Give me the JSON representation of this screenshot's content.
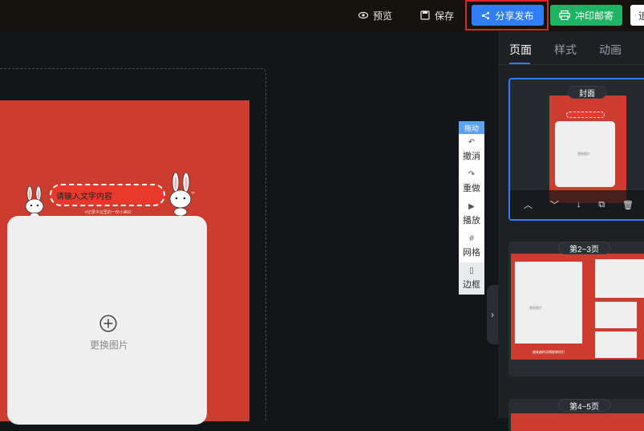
{
  "topbar": {
    "preview_label": "预览",
    "save_label": "保存",
    "share_label": "分享发布",
    "print_label": "冲印邮寄",
    "extra_label": "追"
  },
  "canvas": {
    "title_placeholder": "请输入文字内容",
    "subtitle": "#记录平淡里的一份小美好",
    "replace_image_label": "更换图片"
  },
  "toolbox": {
    "drag_label": "拖动",
    "undo_label": "撤消",
    "redo_label": "重做",
    "play_label": "播放",
    "grid_label": "网格",
    "border_label": "边框"
  },
  "panel": {
    "tabs": [
      {
        "label": "页面"
      },
      {
        "label": "样式"
      },
      {
        "label": "动画"
      }
    ],
    "pages": [
      {
        "badge": "封面",
        "thumb_caption": "更换图片"
      },
      {
        "badge": "第2~3页",
        "thumb_caption": "更换图片",
        "inner_caption": "越来越的深情能够你们"
      },
      {
        "badge": "第4~5页"
      }
    ]
  },
  "colors": {
    "accent": "#2f7ef6",
    "print_green": "#1fb463",
    "page_red": "#cc3d2f",
    "highlight_red": "#e0262a"
  }
}
